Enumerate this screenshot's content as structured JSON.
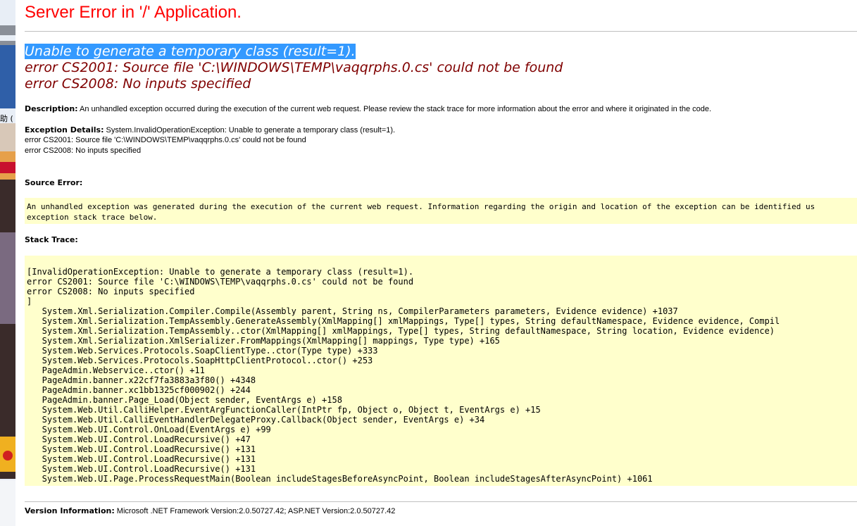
{
  "title": "Server Error in '/' Application.",
  "error_lines": [
    "Unable to generate a temporary class (result=1).",
    "error CS2001: Source file 'C:\\WINDOWS\\TEMP\\vaqqrphs.0.cs' could not be found",
    "error CS2008: No inputs specified"
  ],
  "description": {
    "label": "Description:",
    "text": "An unhandled exception occurred during the execution of the current web request. Please review the stack trace for more information about the error and where it originated in the code."
  },
  "exception_details": {
    "label": "Exception Details:",
    "line1": "System.InvalidOperationException: Unable to generate a temporary class (result=1).",
    "line2": "error CS2001: Source file 'C:\\WINDOWS\\TEMP\\vaqqrphs.0.cs' could not be found",
    "line3": "error CS2008: No inputs specified"
  },
  "source_error": {
    "label": "Source Error:",
    "line1": "An unhandled exception was generated during the execution of the current web request. Information regarding the origin and location of the exception can be identified us",
    "line2": "exception stack trace below."
  },
  "stack_trace": {
    "label": "Stack Trace:",
    "lines": [
      "[InvalidOperationException: Unable to generate a temporary class (result=1).",
      "error CS2001: Source file 'C:\\WINDOWS\\TEMP\\vaqqrphs.0.cs' could not be found",
      "error CS2008: No inputs specified",
      "]",
      "   System.Xml.Serialization.Compiler.Compile(Assembly parent, String ns, CompilerParameters parameters, Evidence evidence) +1037",
      "   System.Xml.Serialization.TempAssembly.GenerateAssembly(XmlMapping[] xmlMappings, Type[] types, String defaultNamespace, Evidence evidence, Compil",
      "   System.Xml.Serialization.TempAssembly..ctor(XmlMapping[] xmlMappings, Type[] types, String defaultNamespace, String location, Evidence evidence)",
      "   System.Xml.Serialization.XmlSerializer.FromMappings(XmlMapping[] mappings, Type type) +165",
      "   System.Web.Services.Protocols.SoapClientType..ctor(Type type) +333",
      "   System.Web.Services.Protocols.SoapHttpClientProtocol..ctor() +253",
      "   PageAdmin.Webservice..ctor() +11",
      "   PageAdmin.banner.x22cf7fa3883a3f80() +4348",
      "   PageAdmin.banner.xc1bb1325cf000902() +244",
      "   PageAdmin.banner.Page_Load(Object sender, EventArgs e) +158",
      "   System.Web.Util.CalliHelper.EventArgFunctionCaller(IntPtr fp, Object o, Object t, EventArgs e) +15",
      "   System.Web.Util.CalliEventHandlerDelegateProxy.Callback(Object sender, EventArgs e) +34",
      "   System.Web.UI.Control.OnLoad(EventArgs e) +99",
      "   System.Web.UI.Control.LoadRecursive() +47",
      "   System.Web.UI.Control.LoadRecursive() +131",
      "   System.Web.UI.Control.LoadRecursive() +131",
      "   System.Web.UI.Control.LoadRecursive() +131",
      "   System.Web.UI.Page.ProcessRequestMain(Boolean includeStagesBeforeAsyncPoint, Boolean includeStagesAfterAsyncPoint) +1061"
    ]
  },
  "version": {
    "label": "Version Information:",
    "text": "Microsoft .NET Framework Version:2.0.50727.42; ASP.NET Version:2.0.50727.42"
  },
  "left_window_fragment": "助 ("
}
